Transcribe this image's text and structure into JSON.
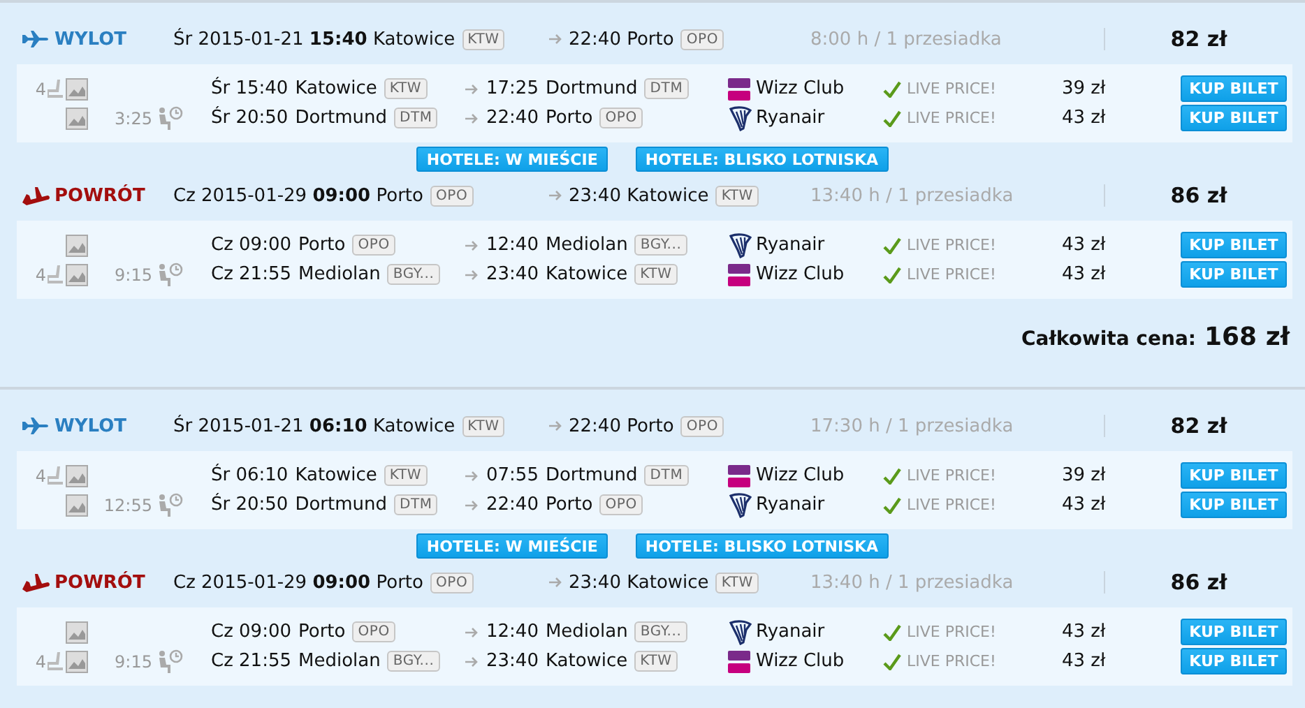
{
  "offers": [
    {
      "outbound": {
        "kind": "outbound",
        "label": "WYLOT",
        "departure": "Śr 2015-01-21 **15:40** Katowice",
        "from_code": "KTW",
        "arrival": "22:40 Porto",
        "to_code": "OPO",
        "duration": "8:00 h / 1 przesiadka",
        "price": "82 zł",
        "segments": [
          {
            "seats": "4",
            "departure": "Śr 15:40",
            "from": "Katowice",
            "from_code": "KTW",
            "arrival": "17:25",
            "to": "Dortmund",
            "to_code": "DTM",
            "airline": {
              "kind": "wizz",
              "name": "Wizz Club"
            },
            "live": "LIVE PRICE!",
            "price": "39 zł",
            "button": "KUP BILET"
          },
          {
            "layover": "3:25",
            "departure": "Śr 20:50",
            "from": "Dortmund",
            "from_code": "DTM",
            "arrival": "22:40",
            "to": "Porto",
            "to_code": "OPO",
            "airline": {
              "kind": "ryanair",
              "name": "Ryanair"
            },
            "live": "LIVE PRICE!",
            "price": "43 zł",
            "button": "KUP BILET"
          }
        ]
      },
      "hotels": [
        "HOTELE: W MIEŚCIE",
        "HOTELE: BLISKO LOTNISKA"
      ],
      "return": {
        "kind": "return",
        "label": "POWRÓT",
        "departure": "Cz 2015-01-29 **09:00** Porto",
        "from_code": "OPO",
        "arrival": "23:40 Katowice",
        "to_code": "KTW",
        "duration": "13:40 h / 1 przesiadka",
        "price": "86 zł",
        "segments": [
          {
            "departure": "Cz 09:00",
            "from": "Porto",
            "from_code": "OPO",
            "arrival": "12:40",
            "to": "Mediolan",
            "to_code": "BGY...",
            "airline": {
              "kind": "ryanair",
              "name": "Ryanair"
            },
            "live": "LIVE PRICE!",
            "price": "43 zł",
            "button": "KUP BILET"
          },
          {
            "seats": "4",
            "layover": "9:15",
            "departure": "Cz 21:55",
            "from": "Mediolan",
            "from_code": "BGY...",
            "arrival": "23:40",
            "to": "Katowice",
            "to_code": "KTW",
            "airline": {
              "kind": "wizz",
              "name": "Wizz Club"
            },
            "live": "LIVE PRICE!",
            "price": "43 zł",
            "button": "KUP BILET"
          }
        ]
      },
      "total": {
        "label": "Całkowita cena:",
        "amount": "168 zł"
      }
    },
    {
      "outbound": {
        "kind": "outbound",
        "label": "WYLOT",
        "departure": "Śr 2015-01-21 **06:10** Katowice",
        "from_code": "KTW",
        "arrival": "22:40 Porto",
        "to_code": "OPO",
        "duration": "17:30 h / 1 przesiadka",
        "price": "82 zł",
        "segments": [
          {
            "seats": "4",
            "departure": "Śr 06:10",
            "from": "Katowice",
            "from_code": "KTW",
            "arrival": "07:55",
            "to": "Dortmund",
            "to_code": "DTM",
            "airline": {
              "kind": "wizz",
              "name": "Wizz Club"
            },
            "live": "LIVE PRICE!",
            "price": "39 zł",
            "button": "KUP BILET"
          },
          {
            "layover": "12:55",
            "departure": "Śr 20:50",
            "from": "Dortmund",
            "from_code": "DTM",
            "arrival": "22:40",
            "to": "Porto",
            "to_code": "OPO",
            "airline": {
              "kind": "ryanair",
              "name": "Ryanair"
            },
            "live": "LIVE PRICE!",
            "price": "43 zł",
            "button": "KUP BILET"
          }
        ]
      },
      "hotels": [
        "HOTELE: W MIEŚCIE",
        "HOTELE: BLISKO LOTNISKA"
      ],
      "return": {
        "kind": "return",
        "label": "POWRÓT",
        "departure": "Cz 2015-01-29 **09:00** Porto",
        "from_code": "OPO",
        "arrival": "23:40 Katowice",
        "to_code": "KTW",
        "duration": "13:40 h / 1 przesiadka",
        "price": "86 zł",
        "segments": [
          {
            "departure": "Cz 09:00",
            "from": "Porto",
            "from_code": "OPO",
            "arrival": "12:40",
            "to": "Mediolan",
            "to_code": "BGY...",
            "airline": {
              "kind": "ryanair",
              "name": "Ryanair"
            },
            "live": "LIVE PRICE!",
            "price": "43 zł",
            "button": "KUP BILET"
          },
          {
            "seats": "4",
            "layover": "9:15",
            "departure": "Cz 21:55",
            "from": "Mediolan",
            "from_code": "BGY...",
            "arrival": "23:40",
            "to": "Katowice",
            "to_code": "KTW",
            "airline": {
              "kind": "wizz",
              "name": "Wizz Club"
            },
            "live": "LIVE PRICE!",
            "price": "43 zł",
            "button": "KUP BILET"
          }
        ]
      }
    }
  ]
}
